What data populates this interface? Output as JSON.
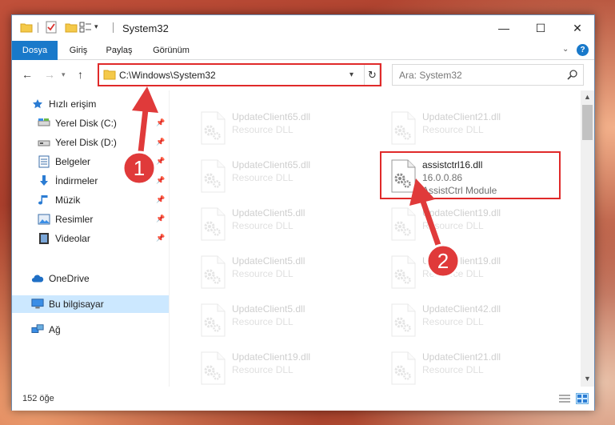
{
  "title_bar": {
    "title": "System32",
    "minimize_glyph": "—",
    "maximize_glyph": "☐",
    "close_glyph": "✕"
  },
  "ribbon": {
    "tabs": [
      "Dosya",
      "Giriş",
      "Paylaş",
      "Görünüm"
    ],
    "help_glyph": "?"
  },
  "navigation": {
    "address": "C:\\Windows\\System32",
    "search_placeholder": "Ara: System32"
  },
  "nav_pane": {
    "items": [
      {
        "label": "Hızlı erişim",
        "icon": "star-icon",
        "pinned": false
      },
      {
        "label": "Yerel Disk (C:)",
        "icon": "drive-icon",
        "pinned": true
      },
      {
        "label": "Yerel Disk (D:)",
        "icon": "drive-icon",
        "pinned": true
      },
      {
        "label": "Belgeler",
        "icon": "documents-icon",
        "pinned": true
      },
      {
        "label": "İndirmeler",
        "icon": "download-icon",
        "pinned": true
      },
      {
        "label": "Müzik",
        "icon": "music-icon",
        "pinned": true
      },
      {
        "label": "Resimler",
        "icon": "pictures-icon",
        "pinned": true
      },
      {
        "label": "Videolar",
        "icon": "videos-icon",
        "pinned": true
      },
      {
        "label": "OneDrive",
        "icon": "cloud-icon",
        "pinned": false
      },
      {
        "label": "Bu bilgisayar",
        "icon": "computer-icon",
        "pinned": false,
        "selected": true
      },
      {
        "label": "Ağ",
        "icon": "network-icon",
        "pinned": false
      }
    ]
  },
  "files": [
    {
      "name": "UpdateClient65.dll",
      "line2": "Resource DLL",
      "faded": true
    },
    {
      "name": "UpdateClient21.dll",
      "line2": "Resource DLL",
      "faded": true
    },
    {
      "name": "UpdateClient65.dll",
      "line2": "Resource DLL",
      "faded": true
    },
    {
      "name": "assistctrl16.dll",
      "line2": "16.0.0.86",
      "line3": "AssistCtrl Module",
      "faded": false,
      "highlighted": true
    },
    {
      "name": "UpdateClient5.dll",
      "line2": "Resource DLL",
      "faded": true
    },
    {
      "name": "UpdateClient19.dll",
      "line2": "Resource DLL",
      "faded": true
    },
    {
      "name": "UpdateClient5.dll",
      "line2": "Resource DLL",
      "faded": true
    },
    {
      "name": "UpdateClient19.dll",
      "line2": "Resource DLL",
      "faded": true
    },
    {
      "name": "UpdateClient5.dll",
      "line2": "Resource DLL",
      "faded": true
    },
    {
      "name": "UpdateClient42.dll",
      "line2": "Resource DLL",
      "faded": true
    },
    {
      "name": "UpdateClient19.dll",
      "line2": "Resource DLL",
      "faded": true
    },
    {
      "name": "UpdateClient21.dll",
      "line2": "Resource DLL",
      "faded": true
    }
  ],
  "status_bar": {
    "item_count": "152 öğe"
  },
  "annotations": {
    "step1": "1",
    "step2": "2",
    "color": "#e03a3a"
  }
}
